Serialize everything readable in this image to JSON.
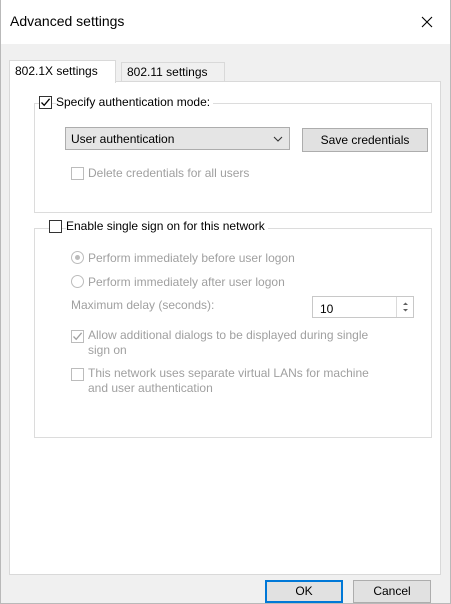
{
  "window": {
    "title": "Advanced settings",
    "close_label": "Close"
  },
  "tabs": [
    {
      "label": "802.1X settings",
      "active": true
    },
    {
      "label": "802.11 settings",
      "active": false
    }
  ],
  "auth": {
    "specify_label": "Specify authentication mode:",
    "specify_checked": true,
    "mode_value": "User authentication",
    "save_credentials_label": "Save credentials",
    "delete_credentials_label": "Delete credentials for all users",
    "delete_credentials_checked": false
  },
  "sso": {
    "enable_label": "Enable single sign on for this network",
    "enable_checked": false,
    "before_logon_label": "Perform immediately before user logon",
    "before_logon_selected": true,
    "after_logon_label": "Perform immediately after user logon",
    "after_logon_selected": false,
    "max_delay_label": "Maximum delay (seconds):",
    "max_delay_value": "10",
    "allow_dialogs_line1": "Allow additional dialogs to be displayed during single",
    "allow_dialogs_line2": "sign on",
    "allow_dialogs_checked": true,
    "vlan_line1": "This network uses separate virtual LANs for machine",
    "vlan_line2": "and user authentication",
    "vlan_checked": false
  },
  "footer": {
    "ok_label": "OK",
    "cancel_label": "Cancel"
  },
  "colors": {
    "accent": "#0078d7",
    "disabled_text": "#a0a0a0"
  }
}
